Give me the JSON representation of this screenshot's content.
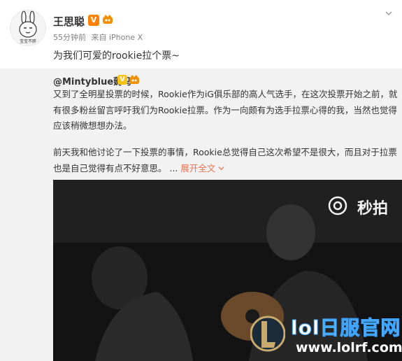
{
  "post": {
    "author": "王思聪",
    "time": "55分钟前",
    "source": "来自 iPhone X",
    "text": "为我们可爱的rookie拉个票~",
    "avatar_caption": "宝宝不胖"
  },
  "repost": {
    "author": "@Mintyblue薅马",
    "paragraph_1": "又到了全明星投票的时候，Rookie作为iG俱乐部的高人气选手，在这次投票开始之前，就有很多粉丝留言呼吁我们为Rookie拉票。作为一向颇有为选手拉票心得的我，当然也觉得应该稍微想想办法。",
    "paragraph_2": "前天我和他讨论了一下投票的事情，Rookie总觉得自己这次希望不是很大，而且对于拉票也是自己觉得有点不好意思。 ...",
    "expand_label": "展开全文",
    "video": {
      "watermark": "秒拍",
      "site_name": "lol日服官网",
      "site_url": "www.lolrf.com"
    }
  },
  "colors": {
    "accent_link": "#eb7350",
    "repost_background": "#f2f2f2",
    "verified_orange": "#ff8200"
  }
}
